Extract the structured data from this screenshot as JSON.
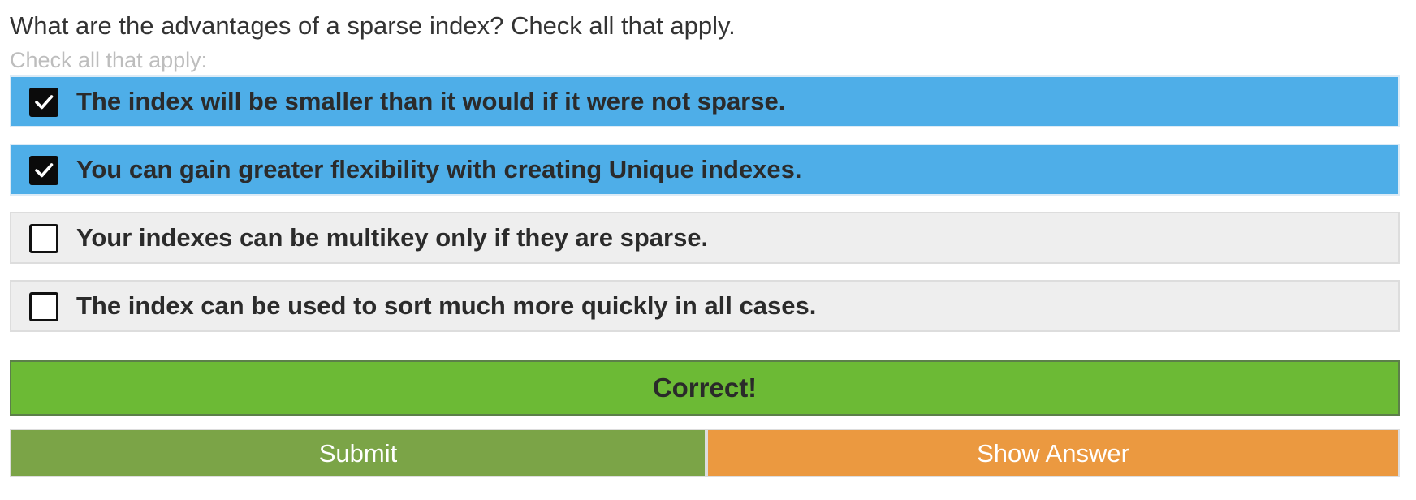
{
  "question": {
    "text": "What are the advantages of a sparse index? Check all that apply.",
    "hint": "Check all that apply:"
  },
  "options": [
    {
      "label": "The index will be smaller than it would if it were not sparse.",
      "checked": true
    },
    {
      "label": "You can gain greater flexibility with creating Unique indexes.",
      "checked": true
    },
    {
      "label": "Your indexes can be multikey only if they are sparse.",
      "checked": false
    },
    {
      "label": "The index can be used to sort much more quickly in all cases.",
      "checked": false
    }
  ],
  "result": {
    "text": "Correct!",
    "color": "#6cba35"
  },
  "actions": {
    "submit_label": "Submit",
    "show_answer_label": "Show Answer"
  },
  "colors": {
    "selected_option": "#4eaee8",
    "unselected_option": "#eeeeee",
    "submit": "#7ba447",
    "show_answer": "#eb9940"
  }
}
